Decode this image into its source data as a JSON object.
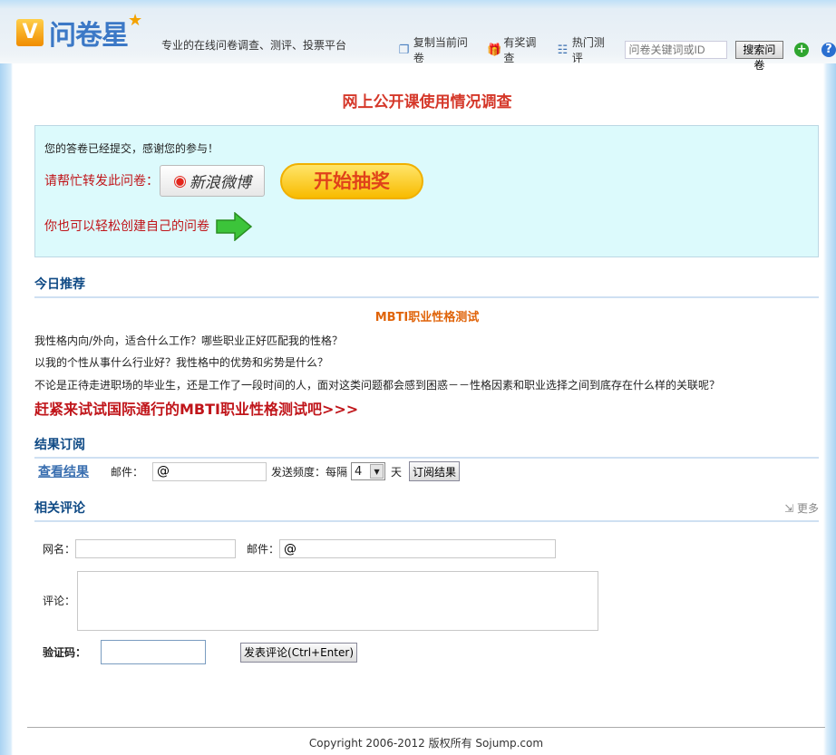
{
  "header": {
    "logo_text": "问卷星",
    "logo_check": "V",
    "slogan": "专业的在线问卷调查、测评、投票平台",
    "links": [
      {
        "label": "复制当前问卷",
        "icon": "copy-icon"
      },
      {
        "label": "有奖调查",
        "icon": "gift-icon"
      },
      {
        "label": "热门测评",
        "icon": "list-icon"
      }
    ],
    "search_placeholder": "问卷关键词或ID",
    "search_button": "搜索问卷",
    "add_icon": "plus-circle-icon",
    "help_icon": "question-circle-icon"
  },
  "title": "网上公开课使用情况调查",
  "panel": {
    "thanks": "您的答卷已经提交，感谢您的参与！",
    "share_label": "请帮忙转发此问卷：",
    "weibo_label": "新浪微博",
    "lottery_label": "开始抽奖",
    "create_label": "你也可以轻松创建自己的问卷"
  },
  "recommend": {
    "heading": "今日推荐",
    "title": "MBTI职业性格测试",
    "lines": [
      "我性格内向/外向，适合什么工作？哪些职业正好匹配我的性格？",
      "以我的个性从事什么行业好？我性格中的优势和劣势是什么？",
      "不论是正待走进职场的毕业生，还是工作了一段时间的人，面对这类问题都会感到困惑－－性格因素和职业选择之间到底存在什么样的关联呢？"
    ],
    "cta": "赶紧来试试国际通行的MBTI职业性格测试吧>>>"
  },
  "subscribe": {
    "heading": "结果订阅",
    "view_link": "查看结果",
    "email_label": "邮件：",
    "email_value": "@",
    "freq_label": "发送频度：每隔",
    "freq_value": "4",
    "unit": "天",
    "button": "订阅结果"
  },
  "comments": {
    "heading": "相关评论",
    "more": "更多",
    "name_label": "网名：",
    "name_value": "",
    "email_label": "邮件：",
    "email_value": "@",
    "comment_label": "评论：",
    "captcha_label": "验证码：",
    "submit": "发表评论(Ctrl+Enter)"
  },
  "footer": "Copyright 2006-2012 版权所有 Sojump.com",
  "colors": {
    "title": "#d5382a",
    "section": "#0f4a85",
    "panel_bg": "#dcfafc",
    "link": "#3a6fb0"
  }
}
